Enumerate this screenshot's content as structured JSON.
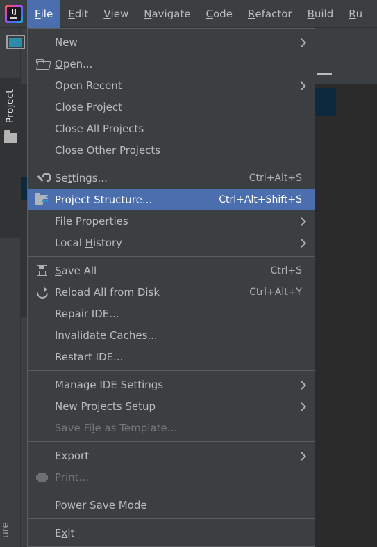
{
  "app": {
    "logo_text": "IJ",
    "logo_name": "intellij-idea-logo"
  },
  "menubar": {
    "items": [
      {
        "label": "File",
        "mnemonic": "F",
        "active": true
      },
      {
        "label": "Edit",
        "mnemonic": "E",
        "active": false
      },
      {
        "label": "View",
        "mnemonic": "V",
        "active": false
      },
      {
        "label": "Navigate",
        "mnemonic": "N",
        "active": false
      },
      {
        "label": "Code",
        "mnemonic": "C",
        "active": false
      },
      {
        "label": "Refactor",
        "mnemonic": "R",
        "active": false
      },
      {
        "label": "Build",
        "mnemonic": "B",
        "active": false
      },
      {
        "label": "Ru",
        "mnemonic": "R",
        "active": false
      }
    ]
  },
  "sidebar": {
    "project_tab_label": "Project",
    "structure_tab_label": "ure",
    "tool_window_icon": "window-icon",
    "project_folder_icon": "folder-icon"
  },
  "file_menu": {
    "groups": [
      {
        "items": [
          {
            "label": "New",
            "mnemonic": "N",
            "icon": null,
            "shortcut": null,
            "submenu": true,
            "disabled": false,
            "selected": false
          },
          {
            "label": "Open...",
            "mnemonic": "O",
            "icon": "folder-open-icon",
            "shortcut": null,
            "submenu": false,
            "disabled": false,
            "selected": false
          },
          {
            "label": "Open Recent",
            "mnemonic": "R",
            "icon": null,
            "shortcut": null,
            "submenu": true,
            "disabled": false,
            "selected": false
          },
          {
            "label": "Close Project",
            "mnemonic": null,
            "icon": null,
            "shortcut": null,
            "submenu": false,
            "disabled": false,
            "selected": false
          },
          {
            "label": "Close All Projects",
            "mnemonic": null,
            "icon": null,
            "shortcut": null,
            "submenu": false,
            "disabled": false,
            "selected": false
          },
          {
            "label": "Close Other Projects",
            "mnemonic": null,
            "icon": null,
            "shortcut": null,
            "submenu": false,
            "disabled": false,
            "selected": false
          }
        ]
      },
      {
        "items": [
          {
            "label": "Settings...",
            "mnemonic": "t",
            "icon": "wrench-icon",
            "shortcut": "Ctrl+Alt+S",
            "submenu": false,
            "disabled": false,
            "selected": false
          },
          {
            "label": "Project Structure...",
            "mnemonic": null,
            "icon": "project-structure-icon",
            "shortcut": "Ctrl+Alt+Shift+S",
            "submenu": false,
            "disabled": false,
            "selected": true
          },
          {
            "label": "File Properties",
            "mnemonic": null,
            "icon": null,
            "shortcut": null,
            "submenu": true,
            "disabled": false,
            "selected": false
          },
          {
            "label": "Local History",
            "mnemonic": "H",
            "icon": null,
            "shortcut": null,
            "submenu": true,
            "disabled": false,
            "selected": false
          }
        ]
      },
      {
        "items": [
          {
            "label": "Save All",
            "mnemonic": "S",
            "icon": "save-icon",
            "shortcut": "Ctrl+S",
            "submenu": false,
            "disabled": false,
            "selected": false
          },
          {
            "label": "Reload All from Disk",
            "mnemonic": null,
            "icon": "reload-icon",
            "shortcut": "Ctrl+Alt+Y",
            "submenu": false,
            "disabled": false,
            "selected": false
          },
          {
            "label": "Repair IDE...",
            "mnemonic": null,
            "icon": null,
            "shortcut": null,
            "submenu": false,
            "disabled": false,
            "selected": false
          },
          {
            "label": "Invalidate Caches...",
            "mnemonic": null,
            "icon": null,
            "shortcut": null,
            "submenu": false,
            "disabled": false,
            "selected": false
          },
          {
            "label": "Restart IDE...",
            "mnemonic": null,
            "icon": null,
            "shortcut": null,
            "submenu": false,
            "disabled": false,
            "selected": false
          }
        ]
      },
      {
        "items": [
          {
            "label": "Manage IDE Settings",
            "mnemonic": null,
            "icon": null,
            "shortcut": null,
            "submenu": true,
            "disabled": false,
            "selected": false
          },
          {
            "label": "New Projects Setup",
            "mnemonic": null,
            "icon": null,
            "shortcut": null,
            "submenu": true,
            "disabled": false,
            "selected": false
          },
          {
            "label": "Save File as Template...",
            "mnemonic": "l",
            "icon": null,
            "shortcut": null,
            "submenu": false,
            "disabled": true,
            "selected": false
          }
        ]
      },
      {
        "items": [
          {
            "label": "Export",
            "mnemonic": null,
            "icon": null,
            "shortcut": null,
            "submenu": true,
            "disabled": false,
            "selected": false
          },
          {
            "label": "Print...",
            "mnemonic": "P",
            "icon": "print-icon",
            "shortcut": null,
            "submenu": false,
            "disabled": true,
            "selected": false
          }
        ]
      },
      {
        "items": [
          {
            "label": "Power Save Mode",
            "mnemonic": null,
            "icon": null,
            "shortcut": null,
            "submenu": false,
            "disabled": false,
            "selected": false
          }
        ]
      },
      {
        "items": [
          {
            "label": "Exit",
            "mnemonic": "x",
            "icon": null,
            "shortcut": null,
            "submenu": false,
            "disabled": false,
            "selected": false
          }
        ]
      }
    ]
  },
  "colors": {
    "menu_bg": "#3c3f41",
    "editor_bg": "#2b2b2b",
    "highlight": "#4b6eaf",
    "text": "#bbbbbb",
    "disabled_text": "#777777",
    "separator": "#5a5d5e",
    "selection_block": "#0d293e",
    "accent_teal": "#2d8ca8"
  }
}
